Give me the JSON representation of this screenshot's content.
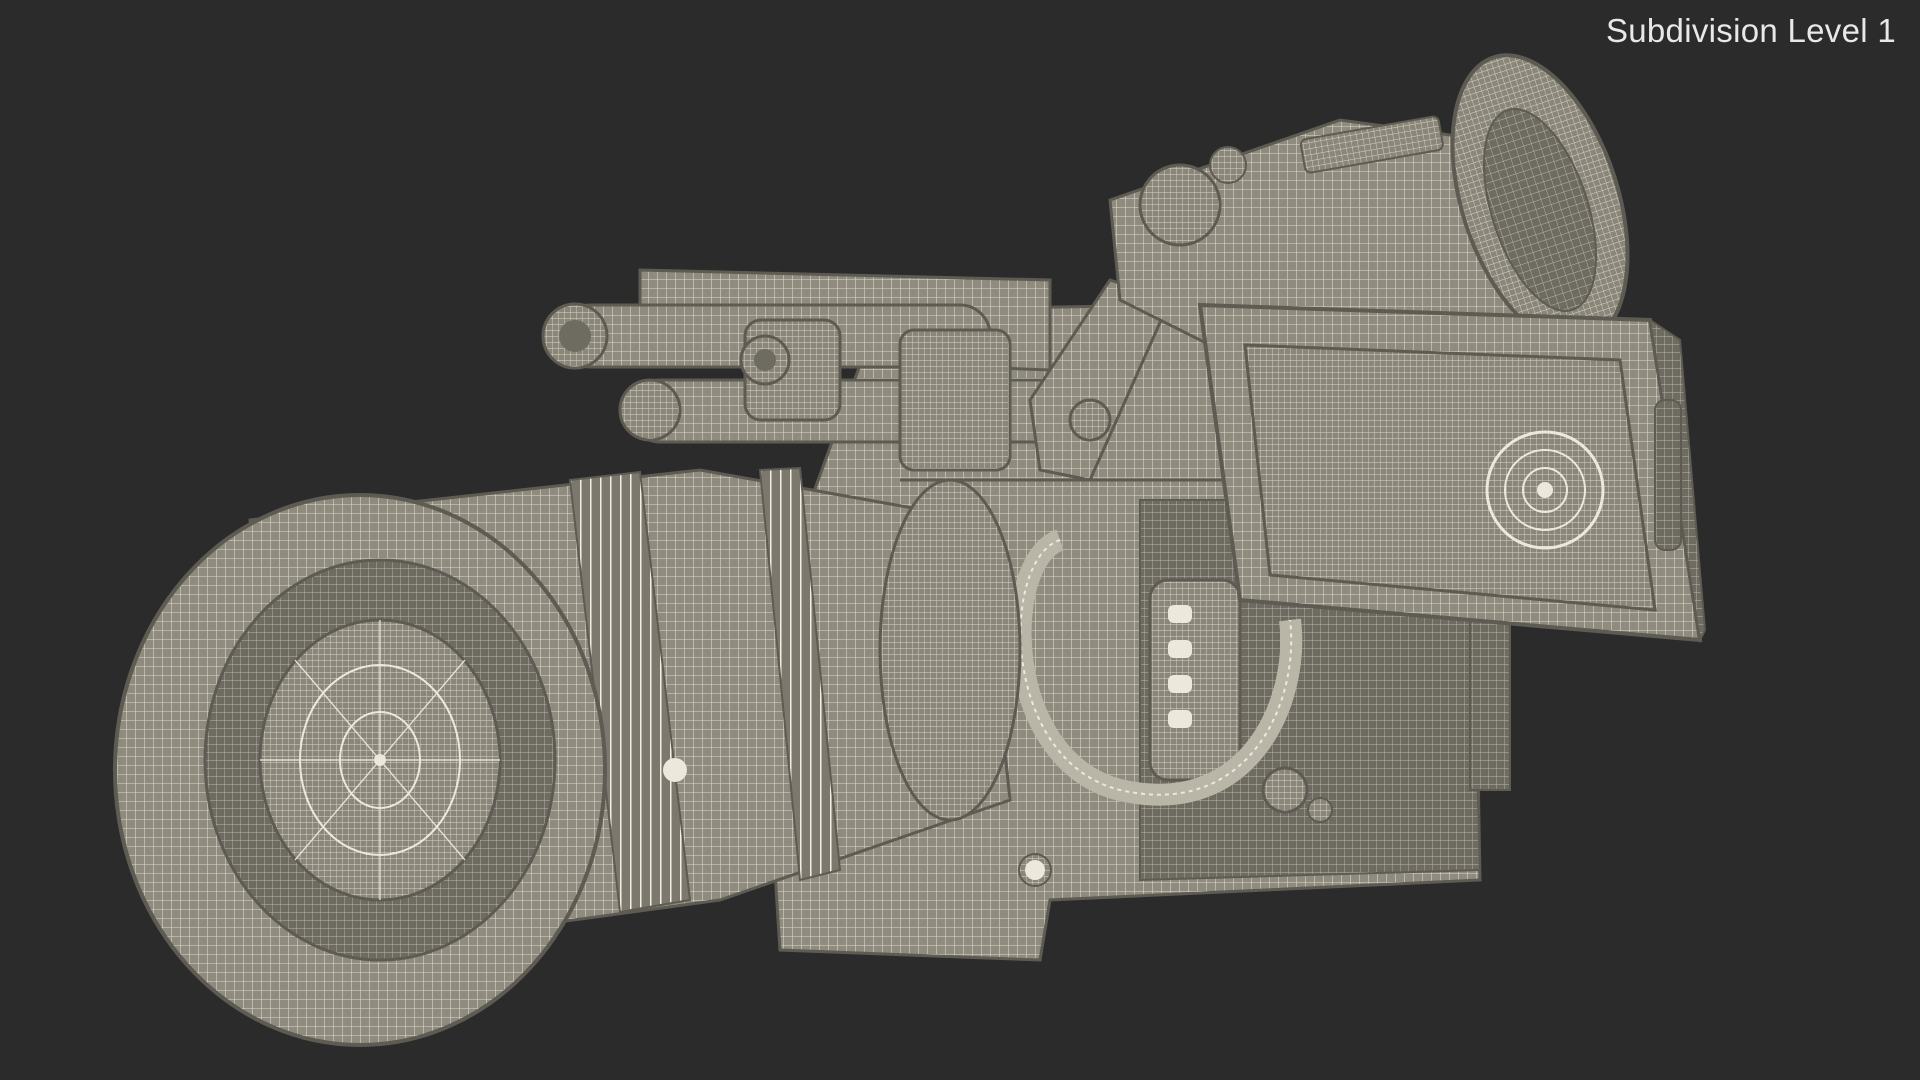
{
  "viewport": {
    "label": "Subdivision Level 1",
    "background": "#2b2b2b",
    "model_subject": "cinema-camera-wireframe",
    "wire_color": "#ece9dc",
    "surface_color": "#8f8b7e",
    "shadow_color": "#5e5b53"
  }
}
